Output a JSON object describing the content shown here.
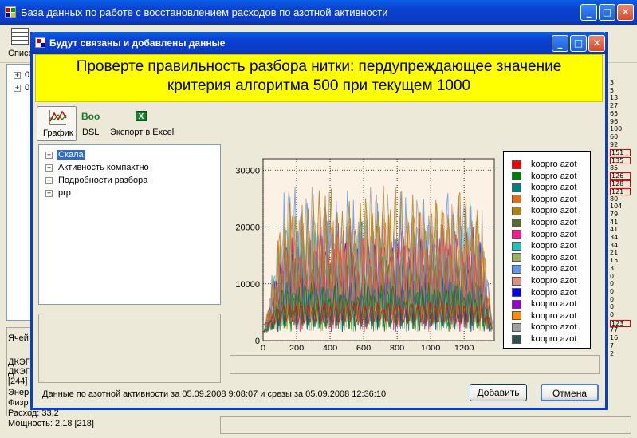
{
  "main_window": {
    "title": "База данных по работе с восстановлением расходов по азотной активности",
    "list_label": "Списо",
    "tree_items": [
      "0",
      "0"
    ],
    "bottom_labels": [
      "Ячей",
      "ДКЭГ",
      "ДКЭГ",
      "[244]",
      "Энер",
      "Физр"
    ],
    "rashod": "Расход: 33,2",
    "moshnost": "Мощность: 2,18 [218]",
    "right_numbers": [
      "3",
      "5",
      "13",
      "27",
      "65",
      "96",
      "100",
      "60",
      "92",
      "151",
      "135",
      "85",
      "126",
      "128",
      "121",
      "80",
      "104",
      "79",
      "41",
      "41",
      "34",
      "34",
      "21",
      "15",
      "3",
      "0",
      "0",
      "0",
      "0",
      "0",
      "0",
      "123",
      "77",
      "16",
      "7",
      "2"
    ],
    "highlighted_numbers": [
      "151",
      "135",
      "126",
      "128",
      "121",
      "123"
    ]
  },
  "dialog": {
    "title": "Будут связаны и добавлены данные",
    "warning_line1": "Проверте правильность разбора нитки: пердупреждающее значение",
    "warning_line2": "критерия алгоритма 500 при текущем 1000",
    "toolbar": {
      "chart_label": "График",
      "boo_text": "Boo",
      "dsl_label": "DSL",
      "excel_label": "Экспорт в Excel",
      "excel_icon_text": "X"
    },
    "tree": [
      "Скала",
      "Активность компактно",
      "Подробности разбора",
      "prp"
    ],
    "status_text": "Данные по азотной активности за 05.09.2008 9:08:07 и срезы за 05.09.2008 12:36:10",
    "add_button": "Добавить",
    "cancel_button": "Отмена"
  },
  "chart_data": {
    "type": "line",
    "x_ticks": [
      "0",
      "200",
      "400",
      "600",
      "800",
      "1000",
      "1200"
    ],
    "y_ticks": [
      "0",
      "10000",
      "20000",
      "30000"
    ],
    "xlim": [
      0,
      1380
    ],
    "ylim": [
      0,
      32000
    ],
    "grid": true,
    "legend_position": "right",
    "series": [
      {
        "name": "koopro  azot",
        "color": "#ff0000"
      },
      {
        "name": "koopro  azot",
        "color": "#008000"
      },
      {
        "name": "koopro  azot",
        "color": "#008080"
      },
      {
        "name": "koopro  azot",
        "color": "#e06c1c"
      },
      {
        "name": "koopro  azot",
        "color": "#b08010"
      },
      {
        "name": "koopro  azot",
        "color": "#556b2f"
      },
      {
        "name": "koopro  azot",
        "color": "#ff1493"
      },
      {
        "name": "koopro  azot",
        "color": "#20c0c0"
      },
      {
        "name": "koopro  azot",
        "color": "#a0b060"
      },
      {
        "name": "koopro  azot",
        "color": "#6495ed"
      },
      {
        "name": "koopro  azot",
        "color": "#e09080"
      },
      {
        "name": "koopro  azot",
        "color": "#0000ff"
      },
      {
        "name": "koopro  azot",
        "color": "#9400d3"
      },
      {
        "name": "koopro  azot",
        "color": "#ff8c00"
      },
      {
        "name": "koopro  azot",
        "color": "#a0a0a0"
      },
      {
        "name": "koopro  azot",
        "color": "#2f4f4f"
      }
    ]
  }
}
